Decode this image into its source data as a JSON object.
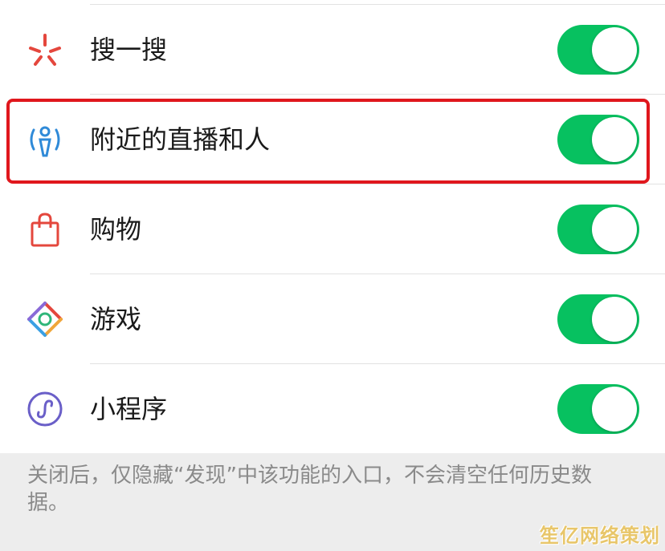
{
  "items": [
    {
      "label": "搜一搜",
      "icon": "search-star-icon",
      "enabled": true
    },
    {
      "label": "附近的直播和人",
      "icon": "nearby-person-icon",
      "enabled": true
    },
    {
      "label": "购物",
      "icon": "shopping-bag-icon",
      "enabled": true
    },
    {
      "label": "游戏",
      "icon": "game-diamond-icon",
      "enabled": true
    },
    {
      "label": "小程序",
      "icon": "mini-program-icon",
      "enabled": true
    }
  ],
  "note": "关闭后，仅隐藏“发现”中该功能的入口，不会清空任何历史数据。",
  "watermark": "笙亿网络策划",
  "colors": {
    "toggle_on": "#07c160",
    "highlight": "#e0171d",
    "background": "#ededed"
  }
}
